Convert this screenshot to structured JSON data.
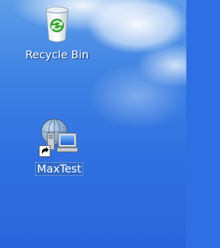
{
  "desktop": {
    "icons": [
      {
        "label": "Recycle Bin",
        "icon": "recycle-bin-icon",
        "selected": false
      },
      {
        "label": "MaxTest",
        "icon": "network-shortcut-icon",
        "selected": true
      }
    ]
  }
}
